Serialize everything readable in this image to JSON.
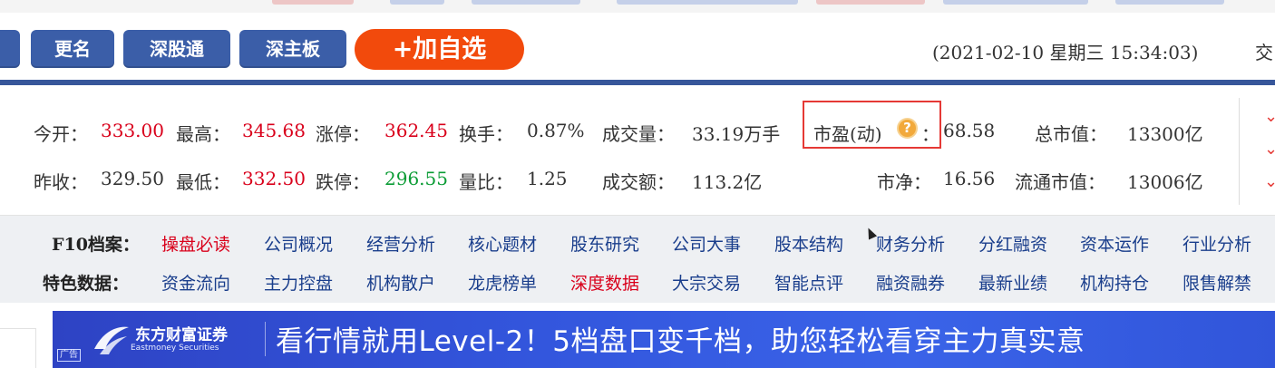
{
  "toolbar": {
    "rename_label": "更名",
    "sgt_label": "深股通",
    "szb_label": "深主板",
    "add_watch_label": "+加自选",
    "datetime": "(2021-02-10 星期三 15:34:03)",
    "trade_cut": "交"
  },
  "quote": {
    "open_label": "今开：",
    "open_value": "333.00",
    "high_label": "最高：",
    "high_value": "345.68",
    "limit_up_label": "涨停：",
    "limit_up_value": "362.45",
    "turnover_label": "换手：",
    "turnover_value": "0.87%",
    "volume_label": "成交量：",
    "volume_value": "33.19万手",
    "pe_label": "市盈(动)",
    "pe_colon": "：",
    "pe_value": "68.58",
    "mktcap_label": "总市值：",
    "mktcap_value": "13300亿",
    "prev_close_label": "昨收：",
    "prev_close_value": "329.50",
    "low_label": "最低：",
    "low_value": "332.50",
    "limit_down_label": "跌停：",
    "limit_down_value": "296.55",
    "vol_ratio_label": "量比：",
    "vol_ratio_value": "1.25",
    "amount_label": "成交额：",
    "amount_value": "113.2亿",
    "pb_label": "市净：",
    "pb_value": "16.56",
    "float_cap_label": "流通市值：",
    "float_cap_value": "13006亿",
    "help_glyph": "?"
  },
  "f10": {
    "label": "F10档案：",
    "items": [
      "操盘必读",
      "公司概况",
      "经营分析",
      "核心题材",
      "股东研究",
      "公司大事",
      "股本结构",
      "财务分析",
      "分红融资",
      "资本运作",
      "行业分析"
    ]
  },
  "feature": {
    "label": "特色数据：",
    "items": [
      "资金流向",
      "主力控盘",
      "机构散户",
      "龙虎榜单",
      "深度数据",
      "大宗交易",
      "智能点评",
      "融资融券",
      "最新业绩",
      "机构持仓",
      "限售解禁"
    ]
  },
  "ad": {
    "tag": "广告",
    "brand": "东方财富证券",
    "brand_en": "Eastmoney Securities",
    "text": "看行情就用Level-2！5档盘口变千档，助您轻松看穿主力真实意"
  },
  "colors": {
    "button_blue": "#3b5ea8",
    "add_orange": "#f24a0c",
    "price_red": "#d9001b",
    "price_green": "#0b9c35",
    "link_blue": "#1a3e8c",
    "highlight_red": "#e53935"
  }
}
